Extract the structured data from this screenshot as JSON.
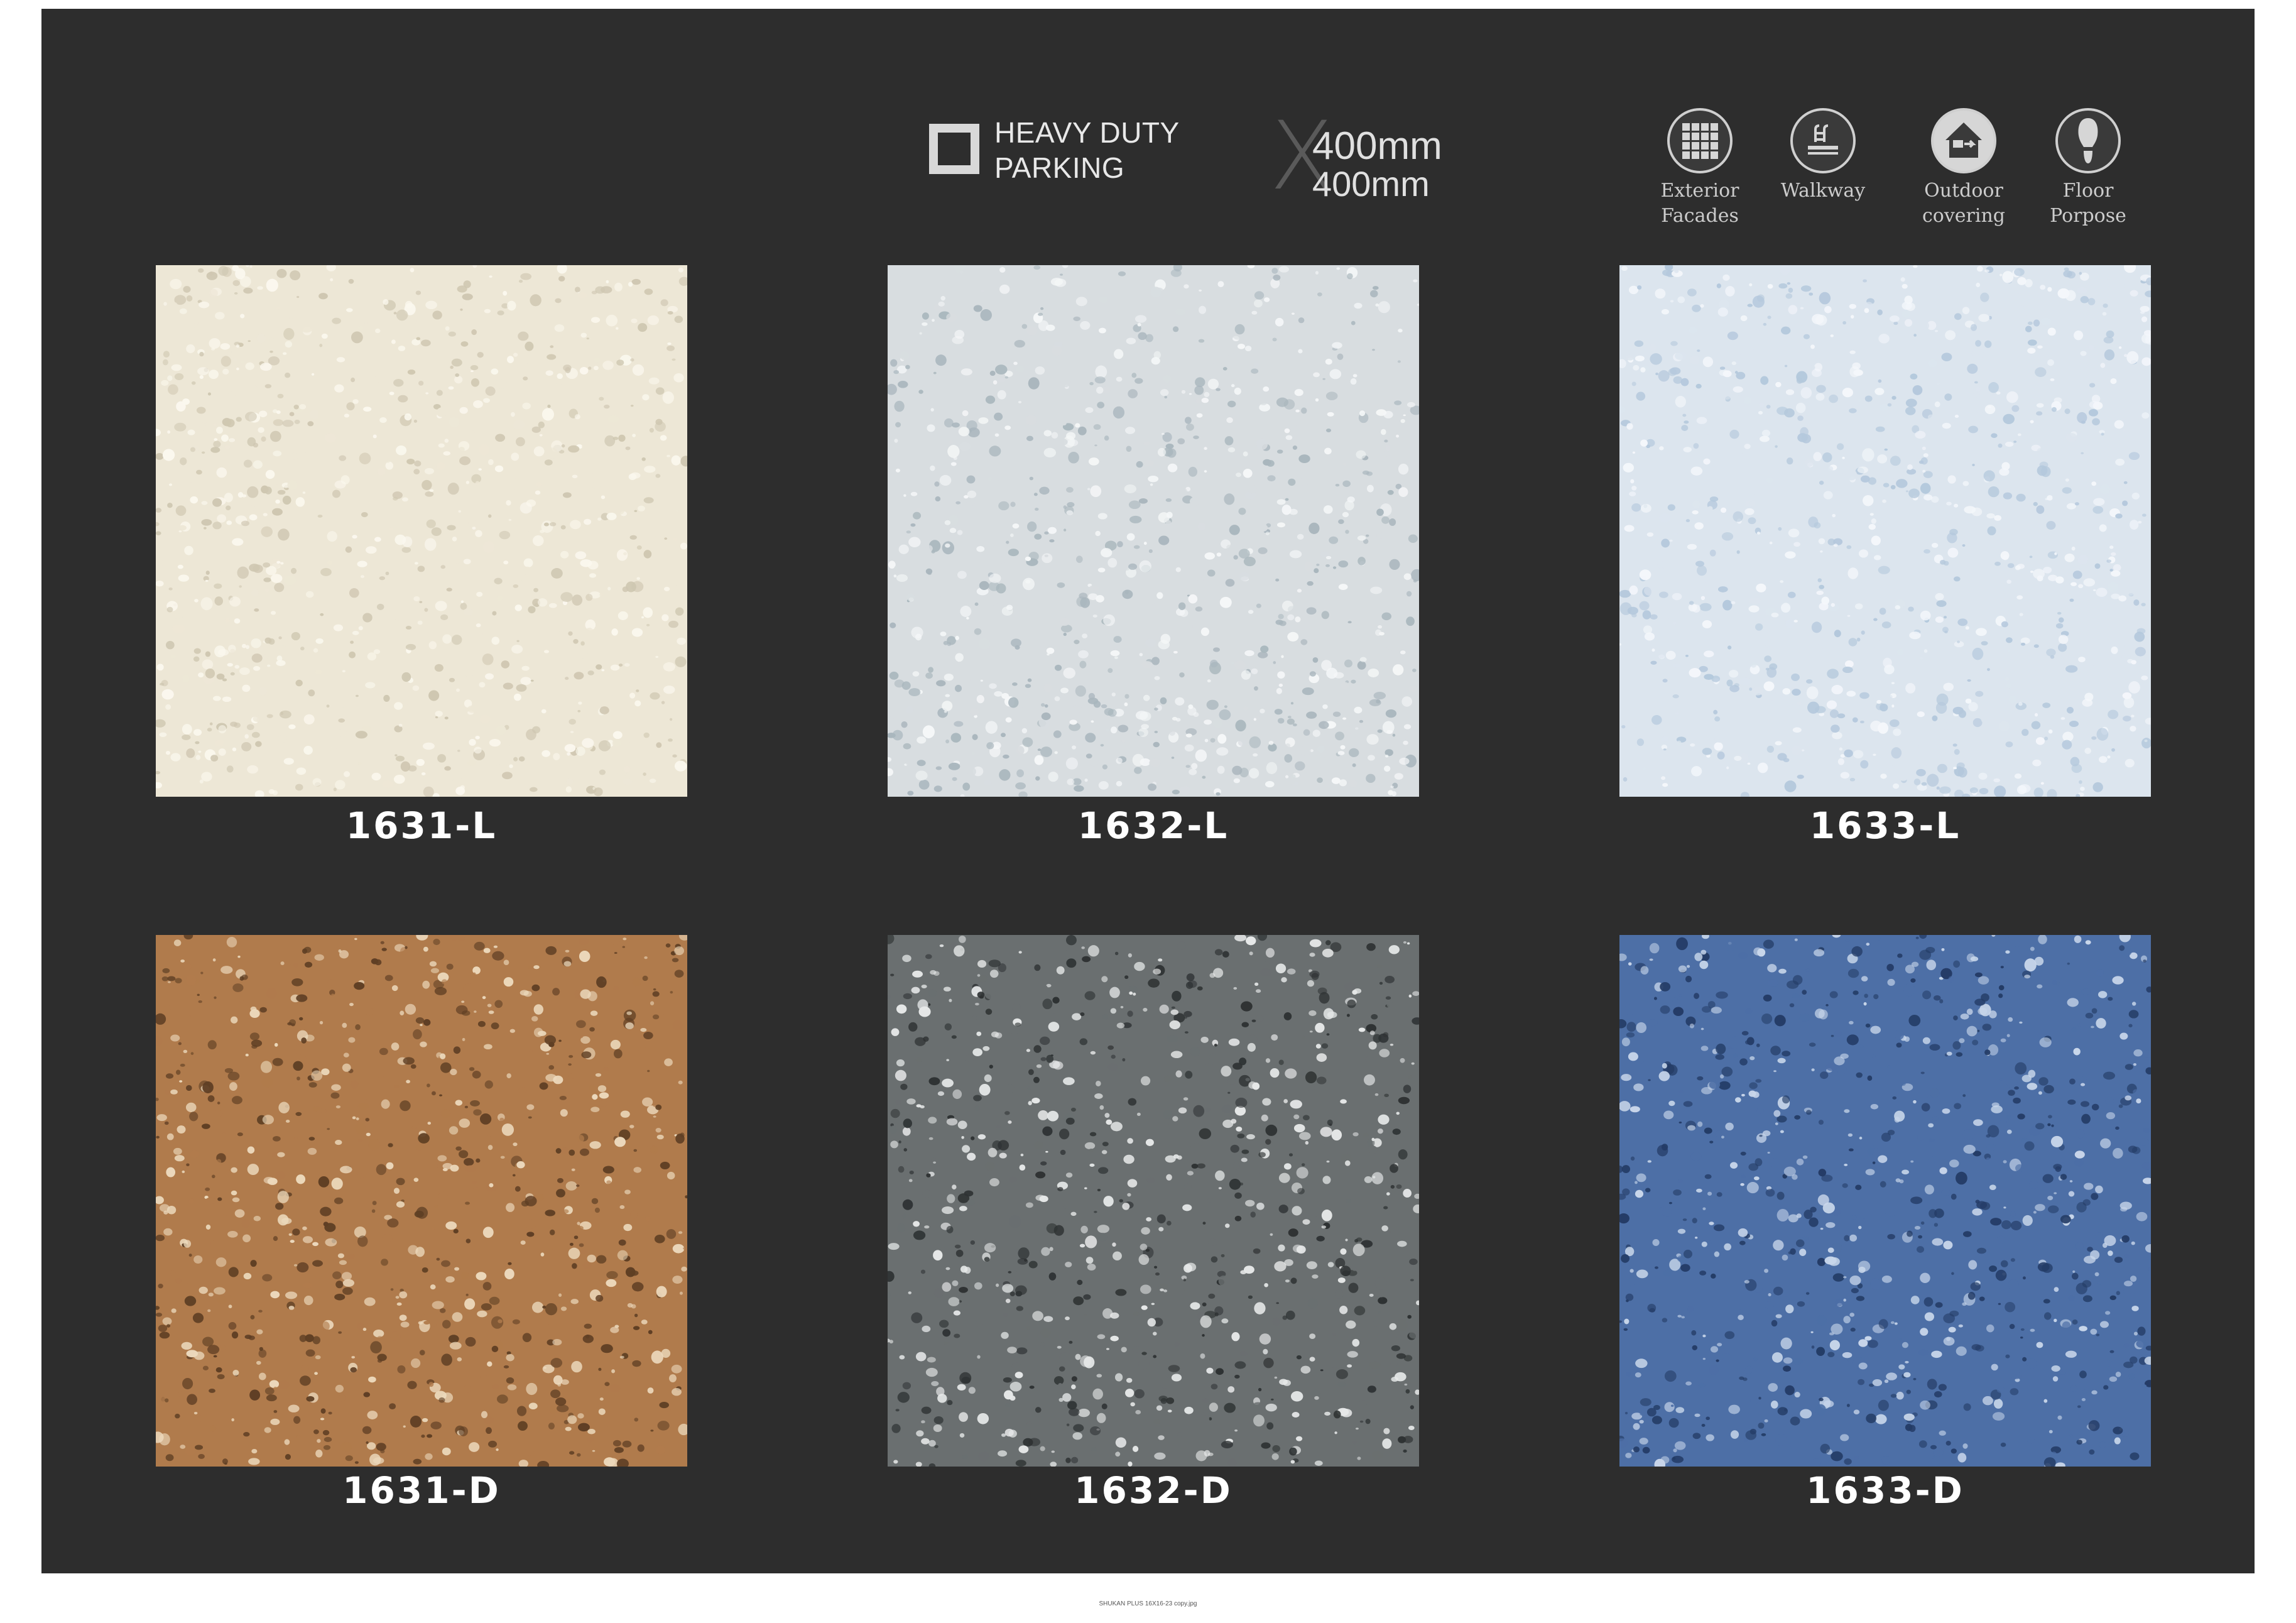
{
  "header": {
    "category_line1": "HEAVY DUTY",
    "category_line2": "PARKING",
    "size_symbol": "X",
    "size_width": "400mm",
    "size_height": "400mm"
  },
  "uses": [
    {
      "label_line1": "Exterior",
      "label_line2": "Facades",
      "icon": "tile-grid-icon"
    },
    {
      "label_line1": "Walkway",
      "label_line2": "",
      "icon": "walkway-icon"
    },
    {
      "label_line1": "Outdoor",
      "label_line2": "covering",
      "icon": "outdoor-house-icon"
    },
    {
      "label_line1": "Floor",
      "label_line2": "Porpose",
      "icon": "footprint-icon"
    }
  ],
  "tiles": [
    {
      "code": "1631-L",
      "base": "#ede7d6",
      "chip_light": "#fbf8ee",
      "chip_dark": "#cfc7b1"
    },
    {
      "code": "1632-L",
      "base": "#d8dde0",
      "chip_light": "#f5f7f8",
      "chip_dark": "#a9b6bd"
    },
    {
      "code": "1633-L",
      "base": "#dce5ee",
      "chip_light": "#f4f7fb",
      "chip_dark": "#b4c8dc"
    },
    {
      "code": "1631-D",
      "base": "#b07b4c",
      "chip_light": "#ecd9bc",
      "chip_dark": "#5f3f24"
    },
    {
      "code": "1632-D",
      "base": "#6a6f70",
      "chip_light": "#e6e8e8",
      "chip_dark": "#2e3233"
    },
    {
      "code": "1633-D",
      "base": "#4d6fa6",
      "chip_light": "#c8d6ea",
      "chip_dark": "#243c66"
    }
  ],
  "footer": {
    "caption": "SHUKAN PLUS 16X16-23 copy.jpg"
  }
}
